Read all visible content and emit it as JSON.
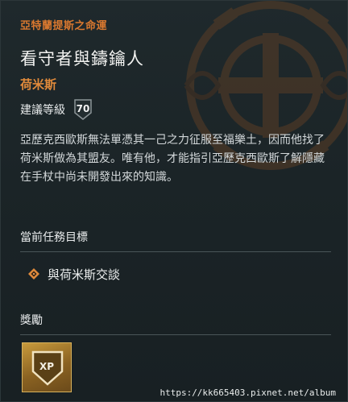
{
  "quest": {
    "questline": "亞特蘭提斯之命運",
    "title": "看守者與鑄鑰人",
    "giver": "荷米斯",
    "level_label": "建議等級",
    "level_value": "70",
    "description": "亞歷克西歐斯無法單憑其一己之力征服至福樂土，因而他找了荷米斯做為其盟友。唯有他，才能指引亞歷克西歐斯了解隱藏在手杖中尚未開發出來的知識。"
  },
  "objectives": {
    "header": "當前任務目標",
    "items": [
      {
        "label": "與荷米斯交談",
        "icon": "diamond-objective-icon"
      }
    ]
  },
  "rewards": {
    "header": "獎勵",
    "items": [
      {
        "label": "XP",
        "icon": "xp-shield-icon"
      }
    ]
  },
  "watermark": "https://kk665403.pixnet.net/album",
  "colors": {
    "accent_orange": "#d9782f",
    "giver_orange": "#e08a3b",
    "panel_bg": "#1c2528",
    "reward_gold": "#b8862e"
  }
}
